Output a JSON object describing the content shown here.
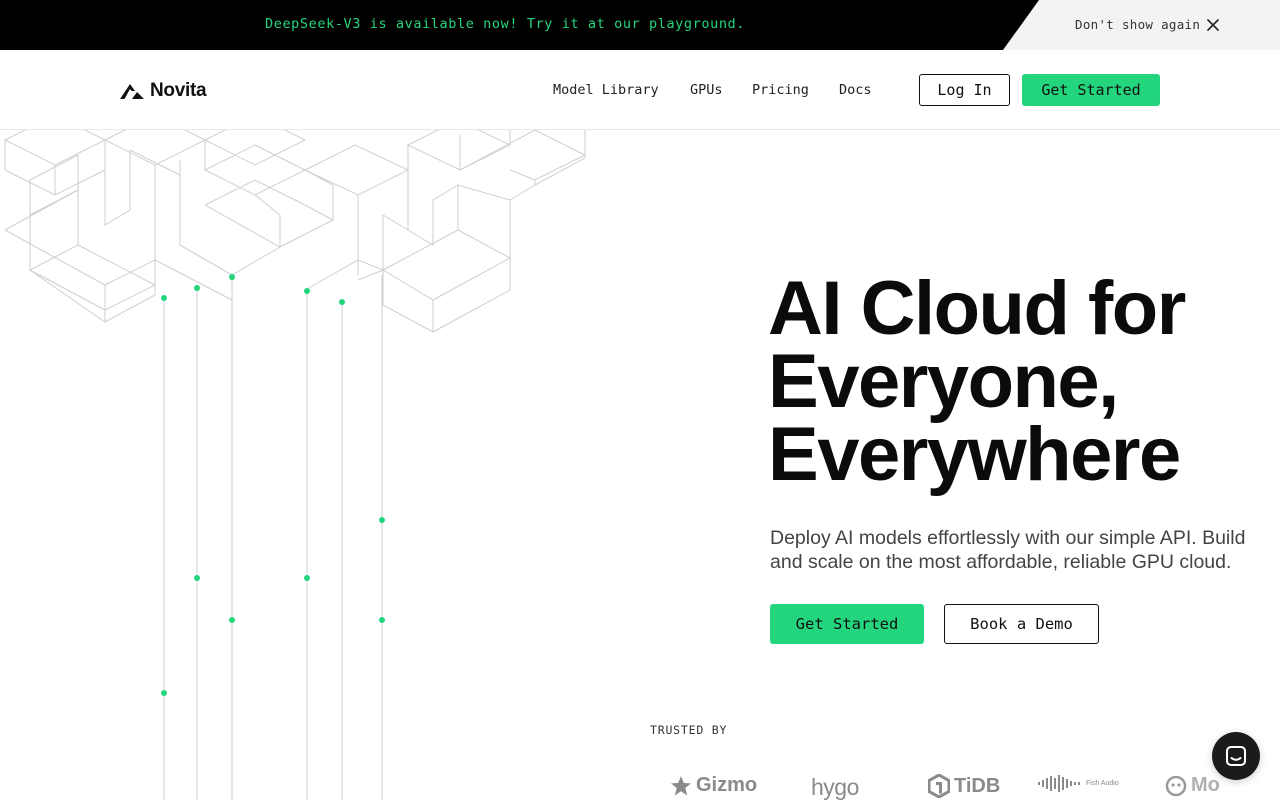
{
  "banner": {
    "message": "DeepSeek-V3 is available now! Try it at our playground.",
    "dismiss_label": "Don't show again",
    "close_icon": "close-icon"
  },
  "nav": {
    "brand": "Novita",
    "links": [
      {
        "label": "Model Library"
      },
      {
        "label": "GPUs"
      },
      {
        "label": "Pricing"
      },
      {
        "label": "Docs"
      }
    ],
    "login_label": "Log In",
    "get_started_label": "Get Started"
  },
  "hero": {
    "title_lines": [
      "AI Cloud for",
      "Everyone,",
      "Everywhere"
    ],
    "subtitle": "Deploy AI models effortlessly with our simple API. Build and scale on the most affordable, reliable GPU cloud.",
    "primary_cta": "Get Started",
    "secondary_cta": "Book a Demo"
  },
  "trusted": {
    "label": "TRUSTED BY",
    "logos": [
      {
        "name": "Gizmo"
      },
      {
        "name": "hygo"
      },
      {
        "name": "TiDB"
      },
      {
        "name": "Fish Audio"
      },
      {
        "name": "Mo"
      }
    ]
  },
  "colors": {
    "accent": "#23d57c",
    "banner_bg": "#000000",
    "text": "#111111"
  },
  "icons": {
    "chat": "chat-icon",
    "logo": "novita-logo-icon"
  }
}
